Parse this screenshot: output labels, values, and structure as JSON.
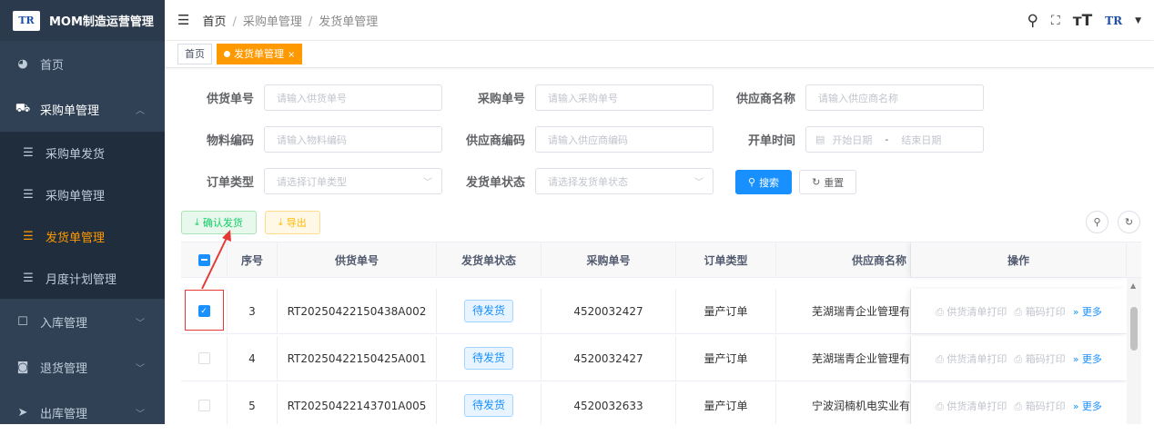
{
  "app": {
    "title": "MOM制造运营管理",
    "logo_text": "TR"
  },
  "sidebar": {
    "items": [
      {
        "label": "首页"
      },
      {
        "label": "采购单管理"
      },
      {
        "label": "入库管理"
      },
      {
        "label": "退货管理"
      },
      {
        "label": "出库管理"
      }
    ],
    "subitems": [
      {
        "label": "采购单发货"
      },
      {
        "label": "采购单管理"
      },
      {
        "label": "发货单管理"
      },
      {
        "label": "月度计划管理"
      }
    ]
  },
  "header": {
    "breadcrumb": [
      "首页",
      "采购单管理",
      "发货单管理"
    ],
    "logo_text": "TR"
  },
  "tags": {
    "home": "首页",
    "active": "发货单管理"
  },
  "search": {
    "supply_no": {
      "label": "供货单号",
      "placeholder": "请输入供货单号"
    },
    "po_no": {
      "label": "采购单号",
      "placeholder": "请输入采购单号"
    },
    "supplier_name": {
      "label": "供应商名称",
      "placeholder": "请输入供应商名称"
    },
    "material_code": {
      "label": "物料编码",
      "placeholder": "请输入物料编码"
    },
    "supplier_code": {
      "label": "供应商编码",
      "placeholder": "请输入供应商编码"
    },
    "open_time": {
      "label": "开单时间",
      "start": "开始日期",
      "dash": "-",
      "end": "结束日期"
    },
    "order_type": {
      "label": "订单类型",
      "placeholder": "请选择订单类型"
    },
    "ship_status": {
      "label": "发货单状态",
      "placeholder": "请选择发货单状态"
    },
    "search_btn": "搜索",
    "reset_btn": "重置"
  },
  "toolbar": {
    "confirm_label": "确认发货",
    "export_label": "导出"
  },
  "table": {
    "headers": [
      "序号",
      "供货单号",
      "发货单状态",
      "采购单号",
      "订单类型",
      "供应商名称",
      "操作"
    ],
    "rows": [
      {
        "checked": true,
        "idx": "3",
        "supply_no": "RT20250422150438A002",
        "status": "待发货",
        "po_no": "4520032427",
        "type": "量产订单",
        "supplier": "芜湖瑞青企业管理有"
      },
      {
        "checked": false,
        "idx": "4",
        "supply_no": "RT20250422150425A001",
        "status": "待发货",
        "po_no": "4520032427",
        "type": "量产订单",
        "supplier": "芜湖瑞青企业管理有"
      },
      {
        "checked": false,
        "idx": "5",
        "supply_no": "RT20250422143701A005",
        "status": "待发货",
        "po_no": "4520032633",
        "type": "量产订单",
        "supplier": "宁波润楠机电实业有"
      }
    ],
    "ops": {
      "print_list": "供货清单打印",
      "print_box": "箱码打印",
      "more": "更多"
    }
  },
  "colors": {
    "sidebar_bg": "#304156",
    "accent": "#ff9900",
    "primary": "#1890ff",
    "annotation": "#e53935"
  },
  "icons": [
    "search-icon",
    "fullscreen-icon",
    "font-size-icon",
    "hamburger-icon",
    "dashboard-icon",
    "cart-icon",
    "list-icon",
    "inbound-icon",
    "return-icon",
    "outbound-icon",
    "calendar-icon",
    "refresh-icon",
    "printer-icon",
    "double-chevron-right-icon"
  ]
}
